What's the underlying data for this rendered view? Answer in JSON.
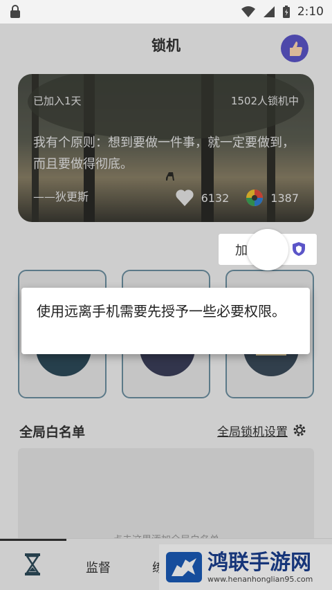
{
  "status": {
    "time": "2:10"
  },
  "header": {
    "title": "锁机"
  },
  "card": {
    "days": "已加入1天",
    "count": "1502人锁机中",
    "quote": "我有个原则：想到要做一件事，就一定要做到，而且要做得彻底。",
    "author": "——狄更斯",
    "likes": "6132",
    "shares": "1387"
  },
  "add_button": {
    "label": "加"
  },
  "dialog": {
    "message": "使用远离手机需要先授予一些必要权限。"
  },
  "whitelist": {
    "title": "全局白名单",
    "settings_link": "全局锁机设置",
    "hint": "点击这里添加全局白名单"
  },
  "tabs": [
    {
      "label": "监督"
    },
    {
      "label": "练"
    }
  ],
  "watermark": {
    "title": "鸿联手游网",
    "url": "www.henanhonglian95.com"
  },
  "colors": {
    "accent": "#6b8fa0",
    "avatar": "#5b55c8",
    "watermark": "#1a5bb8"
  }
}
